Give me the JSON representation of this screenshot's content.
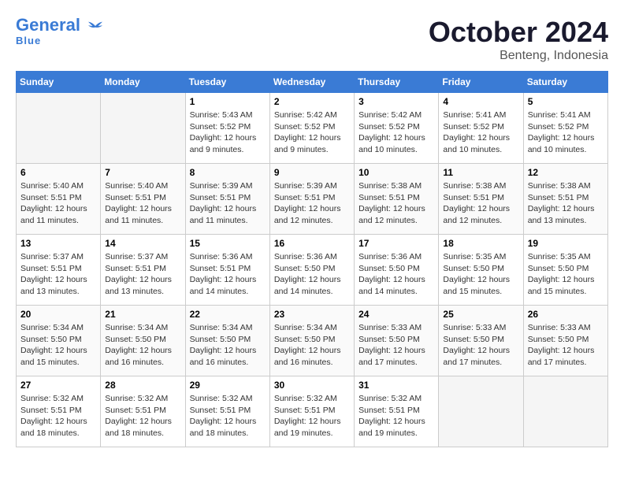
{
  "header": {
    "logo_line1": "General",
    "logo_line2": "Blue",
    "month": "October 2024",
    "location": "Benteng, Indonesia"
  },
  "weekdays": [
    "Sunday",
    "Monday",
    "Tuesday",
    "Wednesday",
    "Thursday",
    "Friday",
    "Saturday"
  ],
  "weeks": [
    [
      {
        "day": "",
        "sunrise": "",
        "sunset": "",
        "daylight": ""
      },
      {
        "day": "",
        "sunrise": "",
        "sunset": "",
        "daylight": ""
      },
      {
        "day": "1",
        "sunrise": "Sunrise: 5:43 AM",
        "sunset": "Sunset: 5:52 PM",
        "daylight": "Daylight: 12 hours and 9 minutes."
      },
      {
        "day": "2",
        "sunrise": "Sunrise: 5:42 AM",
        "sunset": "Sunset: 5:52 PM",
        "daylight": "Daylight: 12 hours and 9 minutes."
      },
      {
        "day": "3",
        "sunrise": "Sunrise: 5:42 AM",
        "sunset": "Sunset: 5:52 PM",
        "daylight": "Daylight: 12 hours and 10 minutes."
      },
      {
        "day": "4",
        "sunrise": "Sunrise: 5:41 AM",
        "sunset": "Sunset: 5:52 PM",
        "daylight": "Daylight: 12 hours and 10 minutes."
      },
      {
        "day": "5",
        "sunrise": "Sunrise: 5:41 AM",
        "sunset": "Sunset: 5:52 PM",
        "daylight": "Daylight: 12 hours and 10 minutes."
      }
    ],
    [
      {
        "day": "6",
        "sunrise": "Sunrise: 5:40 AM",
        "sunset": "Sunset: 5:51 PM",
        "daylight": "Daylight: 12 hours and 11 minutes."
      },
      {
        "day": "7",
        "sunrise": "Sunrise: 5:40 AM",
        "sunset": "Sunset: 5:51 PM",
        "daylight": "Daylight: 12 hours and 11 minutes."
      },
      {
        "day": "8",
        "sunrise": "Sunrise: 5:39 AM",
        "sunset": "Sunset: 5:51 PM",
        "daylight": "Daylight: 12 hours and 11 minutes."
      },
      {
        "day": "9",
        "sunrise": "Sunrise: 5:39 AM",
        "sunset": "Sunset: 5:51 PM",
        "daylight": "Daylight: 12 hours and 12 minutes."
      },
      {
        "day": "10",
        "sunrise": "Sunrise: 5:38 AM",
        "sunset": "Sunset: 5:51 PM",
        "daylight": "Daylight: 12 hours and 12 minutes."
      },
      {
        "day": "11",
        "sunrise": "Sunrise: 5:38 AM",
        "sunset": "Sunset: 5:51 PM",
        "daylight": "Daylight: 12 hours and 12 minutes."
      },
      {
        "day": "12",
        "sunrise": "Sunrise: 5:38 AM",
        "sunset": "Sunset: 5:51 PM",
        "daylight": "Daylight: 12 hours and 13 minutes."
      }
    ],
    [
      {
        "day": "13",
        "sunrise": "Sunrise: 5:37 AM",
        "sunset": "Sunset: 5:51 PM",
        "daylight": "Daylight: 12 hours and 13 minutes."
      },
      {
        "day": "14",
        "sunrise": "Sunrise: 5:37 AM",
        "sunset": "Sunset: 5:51 PM",
        "daylight": "Daylight: 12 hours and 13 minutes."
      },
      {
        "day": "15",
        "sunrise": "Sunrise: 5:36 AM",
        "sunset": "Sunset: 5:51 PM",
        "daylight": "Daylight: 12 hours and 14 minutes."
      },
      {
        "day": "16",
        "sunrise": "Sunrise: 5:36 AM",
        "sunset": "Sunset: 5:50 PM",
        "daylight": "Daylight: 12 hours and 14 minutes."
      },
      {
        "day": "17",
        "sunrise": "Sunrise: 5:36 AM",
        "sunset": "Sunset: 5:50 PM",
        "daylight": "Daylight: 12 hours and 14 minutes."
      },
      {
        "day": "18",
        "sunrise": "Sunrise: 5:35 AM",
        "sunset": "Sunset: 5:50 PM",
        "daylight": "Daylight: 12 hours and 15 minutes."
      },
      {
        "day": "19",
        "sunrise": "Sunrise: 5:35 AM",
        "sunset": "Sunset: 5:50 PM",
        "daylight": "Daylight: 12 hours and 15 minutes."
      }
    ],
    [
      {
        "day": "20",
        "sunrise": "Sunrise: 5:34 AM",
        "sunset": "Sunset: 5:50 PM",
        "daylight": "Daylight: 12 hours and 15 minutes."
      },
      {
        "day": "21",
        "sunrise": "Sunrise: 5:34 AM",
        "sunset": "Sunset: 5:50 PM",
        "daylight": "Daylight: 12 hours and 16 minutes."
      },
      {
        "day": "22",
        "sunrise": "Sunrise: 5:34 AM",
        "sunset": "Sunset: 5:50 PM",
        "daylight": "Daylight: 12 hours and 16 minutes."
      },
      {
        "day": "23",
        "sunrise": "Sunrise: 5:34 AM",
        "sunset": "Sunset: 5:50 PM",
        "daylight": "Daylight: 12 hours and 16 minutes."
      },
      {
        "day": "24",
        "sunrise": "Sunrise: 5:33 AM",
        "sunset": "Sunset: 5:50 PM",
        "daylight": "Daylight: 12 hours and 17 minutes."
      },
      {
        "day": "25",
        "sunrise": "Sunrise: 5:33 AM",
        "sunset": "Sunset: 5:50 PM",
        "daylight": "Daylight: 12 hours and 17 minutes."
      },
      {
        "day": "26",
        "sunrise": "Sunrise: 5:33 AM",
        "sunset": "Sunset: 5:50 PM",
        "daylight": "Daylight: 12 hours and 17 minutes."
      }
    ],
    [
      {
        "day": "27",
        "sunrise": "Sunrise: 5:32 AM",
        "sunset": "Sunset: 5:51 PM",
        "daylight": "Daylight: 12 hours and 18 minutes."
      },
      {
        "day": "28",
        "sunrise": "Sunrise: 5:32 AM",
        "sunset": "Sunset: 5:51 PM",
        "daylight": "Daylight: 12 hours and 18 minutes."
      },
      {
        "day": "29",
        "sunrise": "Sunrise: 5:32 AM",
        "sunset": "Sunset: 5:51 PM",
        "daylight": "Daylight: 12 hours and 18 minutes."
      },
      {
        "day": "30",
        "sunrise": "Sunrise: 5:32 AM",
        "sunset": "Sunset: 5:51 PM",
        "daylight": "Daylight: 12 hours and 19 minutes."
      },
      {
        "day": "31",
        "sunrise": "Sunrise: 5:32 AM",
        "sunset": "Sunset: 5:51 PM",
        "daylight": "Daylight: 12 hours and 19 minutes."
      },
      {
        "day": "",
        "sunrise": "",
        "sunset": "",
        "daylight": ""
      },
      {
        "day": "",
        "sunrise": "",
        "sunset": "",
        "daylight": ""
      }
    ]
  ]
}
